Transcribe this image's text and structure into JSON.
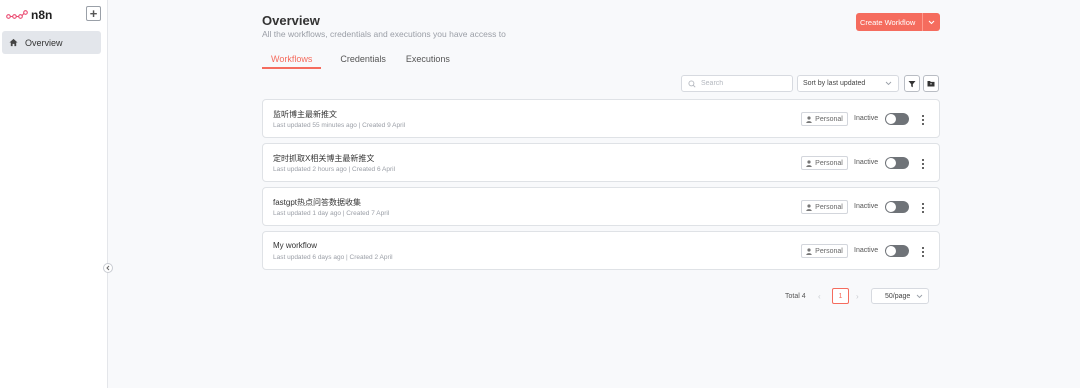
{
  "app": {
    "name": "n8n",
    "accent_color": "#f56c5e"
  },
  "sidebar": {
    "add_icon": "plus-icon",
    "items": [
      {
        "label": "Overview",
        "icon": "home-icon"
      }
    ],
    "collapse_icon": "chevron-left-icon"
  },
  "header": {
    "title": "Overview",
    "subtitle": "All the workflows, credentials and executions you have access to",
    "create_button": "Create Workflow"
  },
  "tabs": [
    {
      "label": "Workflows",
      "active": true
    },
    {
      "label": "Credentials",
      "active": false
    },
    {
      "label": "Executions",
      "active": false
    }
  ],
  "toolbar": {
    "search_placeholder": "Search",
    "sort_value": "Sort by last updated",
    "filter_icon": "filter-icon",
    "folder_icon": "folder-icon"
  },
  "workflows": [
    {
      "name": "监听博主最新推文",
      "updated": "Last updated 55 minutes ago",
      "created": "Created 9 April",
      "owner": "Personal",
      "status": "Inactive",
      "active": false
    },
    {
      "name": "定时抓取X相关博主最新推文",
      "updated": "Last updated 2 hours ago",
      "created": "Created 6 April",
      "owner": "Personal",
      "status": "Inactive",
      "active": false
    },
    {
      "name": "fastgpt热点问答数据收集",
      "updated": "Last updated 1 day ago",
      "created": "Created 7 April",
      "owner": "Personal",
      "status": "Inactive",
      "active": false
    },
    {
      "name": "My workflow",
      "updated": "Last updated 6 days ago",
      "created": "Created 2 April",
      "owner": "Personal",
      "status": "Inactive",
      "active": false
    }
  ],
  "pagination": {
    "total": "Total 4",
    "current_page": "1",
    "page_size": "50/page"
  }
}
